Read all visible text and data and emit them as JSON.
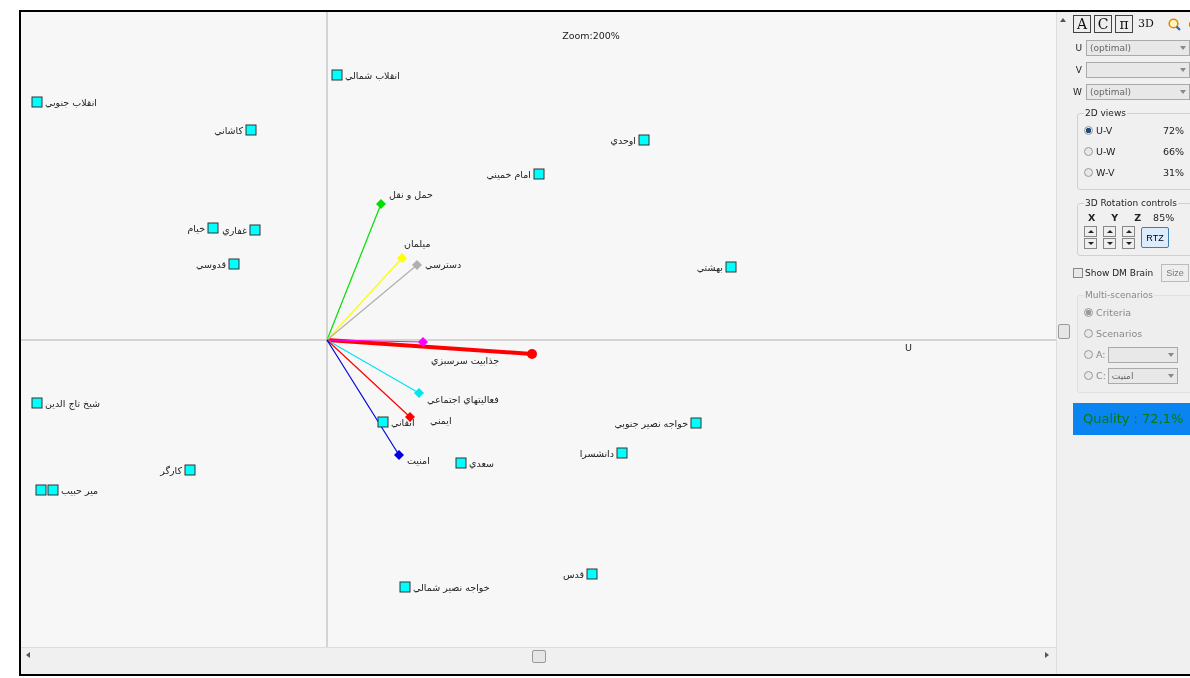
{
  "plot": {
    "zoom": "Zoom:200%",
    "axis_label": "U",
    "alternatives": [
      {
        "kind": "alternative",
        "label": "انقلاب شمالي"
      },
      {
        "kind": "alternative",
        "label": "انقلاب جنوبي"
      },
      {
        "kind": "alternative",
        "label": "كاشاني"
      },
      {
        "kind": "alternative",
        "label": "اوحدي"
      },
      {
        "kind": "alternative",
        "label": "امام خميني"
      },
      {
        "kind": "alternative",
        "label": "غفاري"
      },
      {
        "kind": "alternative",
        "label": "خيام"
      },
      {
        "kind": "alternative",
        "label": "قدوسي"
      },
      {
        "kind": "alternative",
        "label": "بهشتي"
      },
      {
        "kind": "alternative",
        "label": "شيخ تاج الدين"
      },
      {
        "kind": "alternative",
        "label": "انقاني"
      },
      {
        "kind": "alternative",
        "label": "خواجه نصير جنوبي"
      },
      {
        "kind": "alternative",
        "label": "دانشسرا"
      },
      {
        "kind": "alternative",
        "label": "سعدي"
      },
      {
        "kind": "alternative",
        "label": "كارگر"
      },
      {
        "kind": "alternative",
        "label": "مير حبيب"
      },
      {
        "kind": "alternative"
      },
      {
        "kind": "alternative",
        "label": "قدس"
      },
      {
        "kind": "alternative",
        "label": "خواجه نصير شمالي"
      }
    ],
    "criteria": [
      {
        "label": "حمل و نقل",
        "color": "#00e000"
      },
      {
        "label": "ميلمان",
        "color": "#ffff00"
      },
      {
        "label": "دسترسي",
        "color": "#b0b0b0"
      },
      {
        "label": "جذابيت سرسبزي",
        "color": "#ff00ff"
      },
      {
        "label": "فعاليتهاي اجتماعي",
        "color": "#00e5ee"
      },
      {
        "label": "ايمني",
        "color": "#ff0000"
      },
      {
        "label": "امنيت",
        "color": "#0000e0"
      }
    ]
  },
  "panel": {
    "toolbar": {
      "alternatives": "A",
      "criteria": "C",
      "pi": "π",
      "view_3d": "3D"
    },
    "axes": [
      {
        "label": "U",
        "value": "(optimal)"
      },
      {
        "label": "V"
      },
      {
        "label": "W",
        "value": "(optimal)"
      }
    ],
    "views": {
      "title": "2D views",
      "items": [
        {
          "label": "U-V",
          "value": "72%",
          "selected": true
        },
        {
          "label": "U-W",
          "value": "66%",
          "selected": false
        },
        {
          "label": "W-V",
          "value": "31%",
          "selected": false
        }
      ]
    },
    "rotation": {
      "title": "3D Rotation controls",
      "axes": {
        "x": "X",
        "y": "Y",
        "z": "Z"
      },
      "value": "85%",
      "reset": "RTZ"
    },
    "show_dm_brain": {
      "label": "Show DM Brain",
      "checked": false
    },
    "size_button": "Size",
    "multi": {
      "title": "Multi-scenarios",
      "disabled": true,
      "items": [
        {
          "label": "Criteria",
          "selected": true
        },
        {
          "label": "Scenarios",
          "selected": false
        }
      ],
      "selectors": [
        {
          "label": "A:"
        },
        {
          "label": "C:",
          "value": "امنيت"
        }
      ]
    },
    "quality": "Quality : 72,1%"
  }
}
